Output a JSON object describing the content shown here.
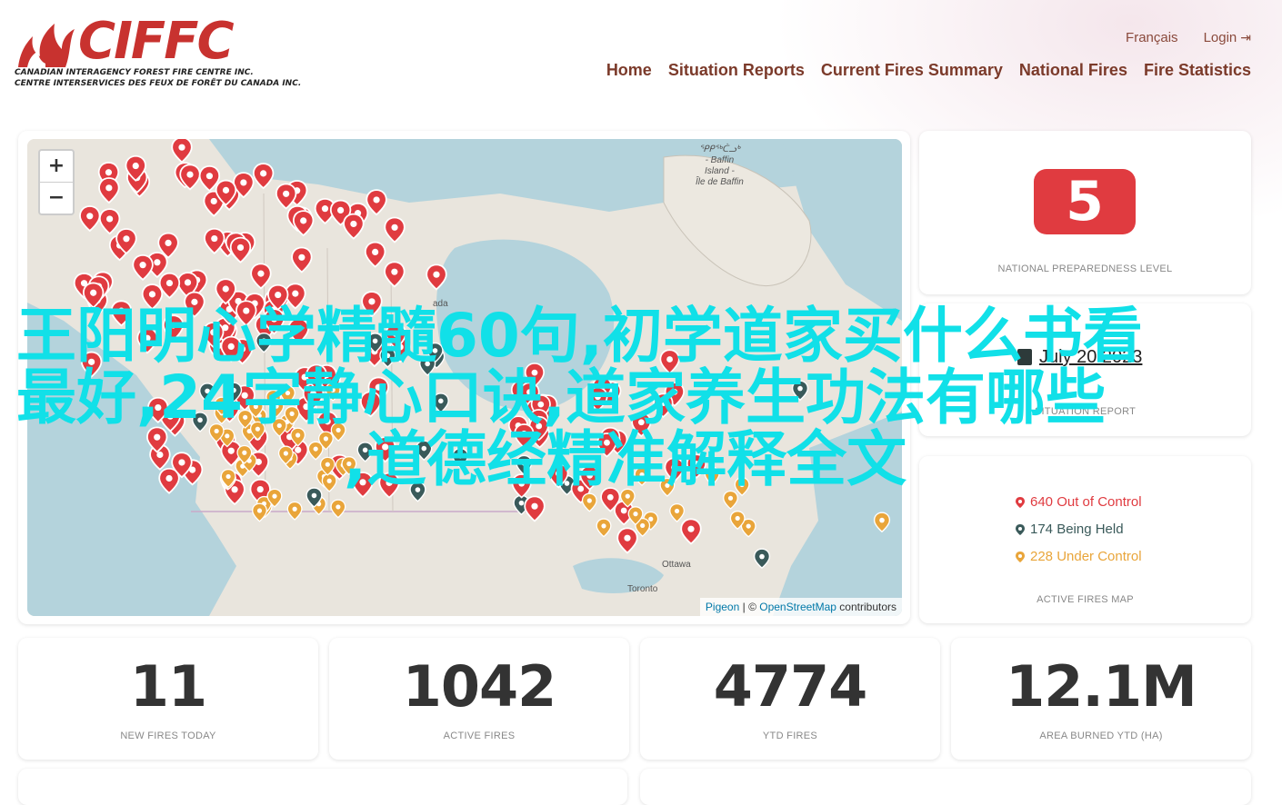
{
  "brand": {
    "name": "CIFFC",
    "line1": "CANADIAN INTERAGENCY FOREST FIRE CENTRE INC.",
    "line2": "CENTRE INTERSERVICES DES FEUX DE FORÊT DU CANADA INC.",
    "color": "#c8322f"
  },
  "utility": {
    "language": "Français",
    "login": "Login",
    "login_icon": "login-arrow-icon"
  },
  "nav": {
    "items": [
      {
        "label": "Home"
      },
      {
        "label": "Situation Reports"
      },
      {
        "label": "Current Fires Summary"
      },
      {
        "label": "National Fires"
      },
      {
        "label": "Fire Statistics"
      }
    ]
  },
  "map": {
    "zoom_in": "+",
    "zoom_out": "−",
    "labels": {
      "baffin_syllabics": "ᕿᑭᖅᑖᓗᒃ",
      "baffin_en1": "- Baffin",
      "baffin_en2": "Island -",
      "baffin_fr": "Île de Baffin",
      "ottawa": "Ottawa",
      "toronto": "Toronto",
      "canada": "ada"
    },
    "attribution": {
      "pigeon": "Pigeon",
      "sep": " | © ",
      "osm": "OpenStreetMap",
      "contributors": " contributors"
    },
    "colors": {
      "out_of_control": "#e03b40",
      "being_held": "#3a5a5a",
      "under_control": "#e9a53a"
    }
  },
  "preparedness": {
    "level": "5",
    "caption": "NATIONAL PREPAREDNESS LEVEL",
    "badge_color": "#e03b40"
  },
  "sitrep": {
    "date": "July 20 2023",
    "caption": "SITUATION REPORT",
    "calendar_icon": "calendar-icon"
  },
  "fires_map": {
    "out_of_control": "640 Out of Control",
    "being_held": "174 Being Held",
    "under_control": "228 Under Control",
    "caption": "ACTIVE FIRES MAP"
  },
  "stats": [
    {
      "value": "11",
      "label": "NEW FIRES TODAY"
    },
    {
      "value": "1042",
      "label": "ACTIVE FIRES"
    },
    {
      "value": "4774",
      "label": "YTD FIRES"
    },
    {
      "value": "12.1M",
      "label": "AREA BURNED YTD (HA)"
    }
  ],
  "watermark": {
    "line1": "王阳明心学精髓60句,初学道家买什么书看",
    "line2": "最好,24字静心口诀,道家养生功法有哪些",
    "line3": ",道德经精准解释全文",
    "color": "#11e0e8"
  }
}
